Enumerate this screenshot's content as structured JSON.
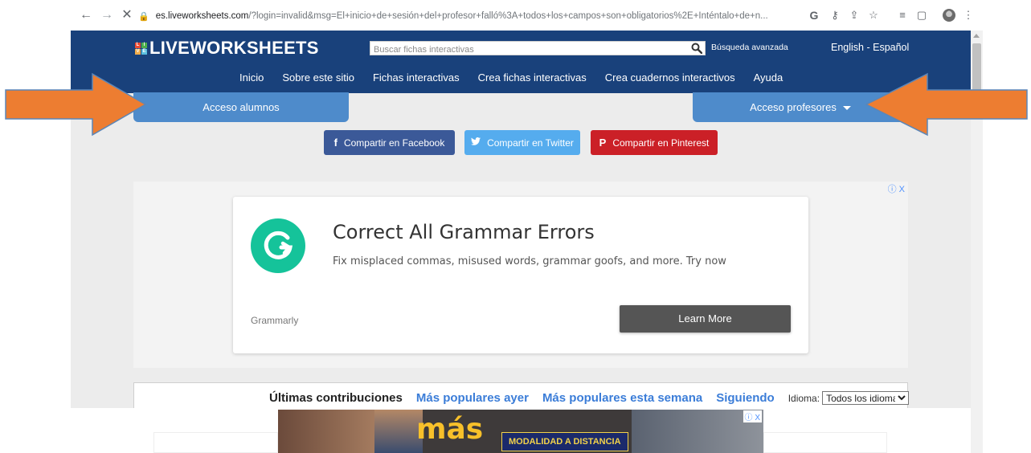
{
  "browser": {
    "url_host": "es.liveworksheets.com",
    "url_rest": "/?login=invalid&msg=El+inicio+de+sesión+del+profesor+falló%3A+todos+los+campos+son+obligatorios%2E+Inténtalo+de+n...",
    "back_icon": "back-arrow-icon",
    "forward_icon": "forward-arrow-icon",
    "stop_icon": "close-icon"
  },
  "header": {
    "logo_text": "LIVEWORKSHEETS",
    "logo_letters": [
      "L",
      "I",
      "V",
      "E"
    ],
    "search_placeholder": "Buscar fichas interactivas",
    "advanced_search": "Búsqueda avanzada",
    "language_switch": "English - Español",
    "nav": [
      "Inicio",
      "Sobre este sitio",
      "Fichas interactivas",
      "Crea fichas interactivas",
      "Crea cuadernos interactivos",
      "Ayuda"
    ]
  },
  "access": {
    "students": "Acceso alumnos",
    "teachers": "Acceso profesores"
  },
  "share": {
    "facebook": "Compartir en Facebook",
    "facebook_icon": "f",
    "twitter": "Compartir en Twitter",
    "twitter_icon": "🐦",
    "pinterest": "Compartir en Pinterest",
    "pinterest_icon": "P"
  },
  "ad": {
    "title": "Correct All Grammar Errors",
    "body": "Fix misplaced commas, misused words, grammar goofs, and more. Try now",
    "brand": "Grammarly",
    "cta": "Learn More",
    "adchoices": "ⓘ X"
  },
  "contributions": {
    "latest": "Últimas contribuciones",
    "popular_yesterday": "Más populares ayer",
    "popular_week": "Más populares esta semana",
    "following": "Siguiendo",
    "language_label": "Idioma:",
    "language_value": "Todos los idiomas"
  },
  "bottom_ad": {
    "headline": "más",
    "badge": "MODALIDAD A DISTANCIA"
  },
  "colors": {
    "header_bg": "#19417b",
    "tab_bg": "#4e8bcb",
    "arrow": "#ed7d31",
    "grammarly_green": "#15c39a"
  }
}
